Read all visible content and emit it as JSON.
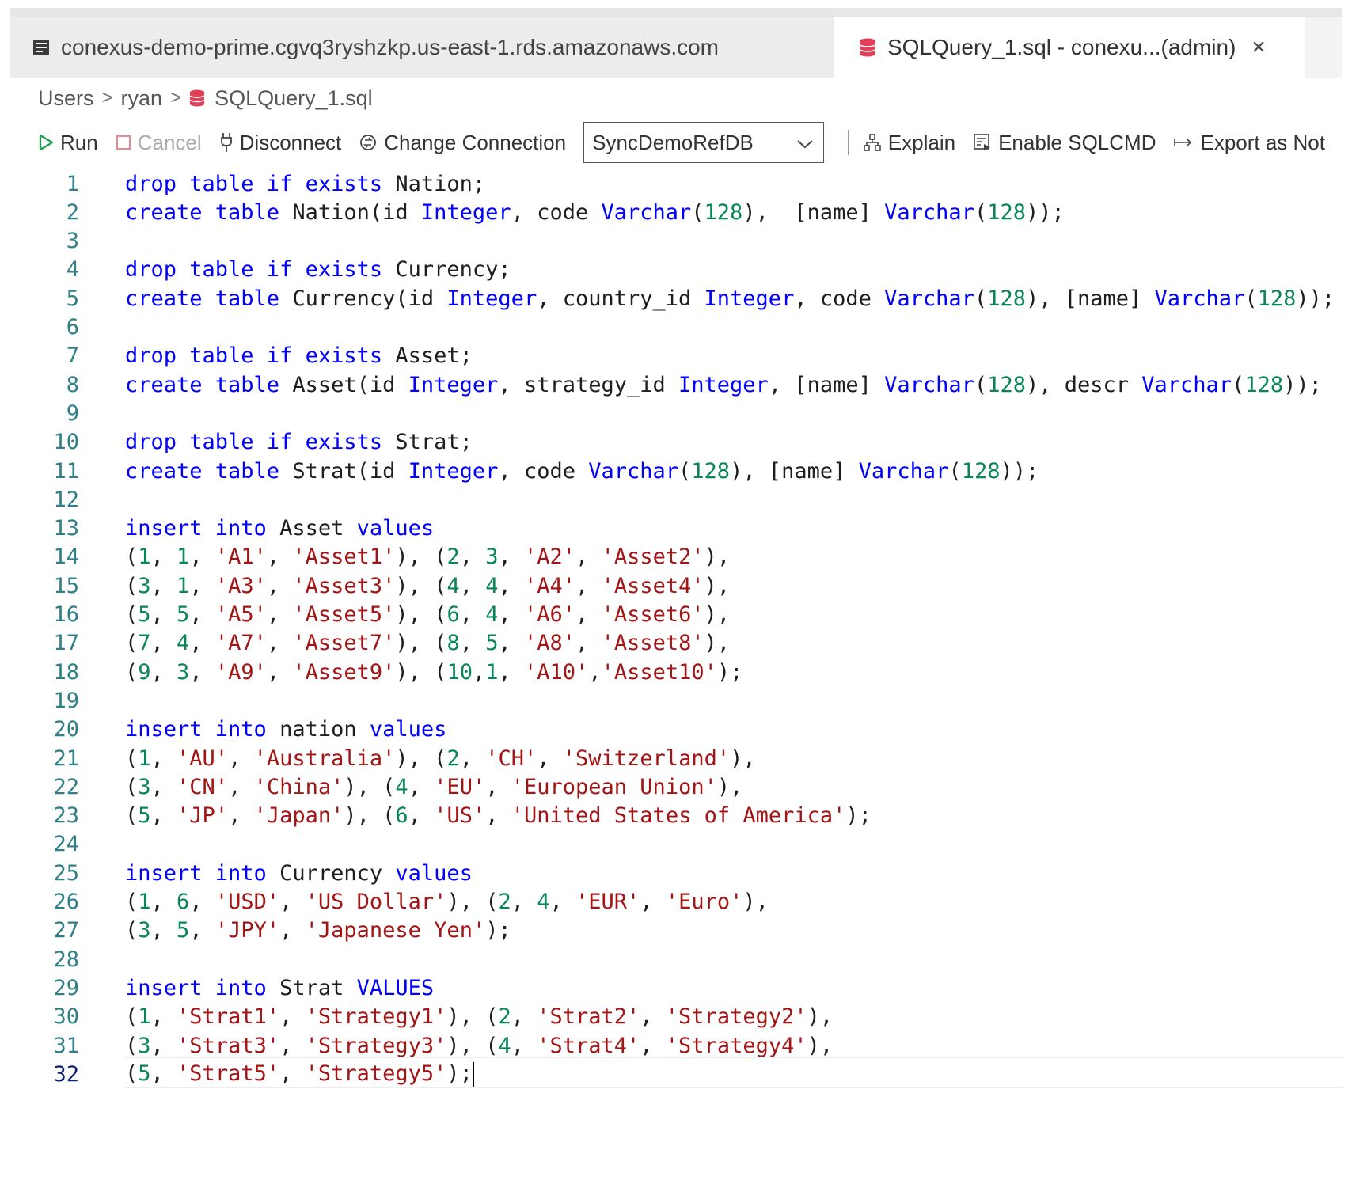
{
  "tabs": [
    {
      "label": "conexus-demo-prime.cgvq3ryshzkp.us-east-1.rds.amazonaws.com",
      "icon": "server-icon"
    },
    {
      "label": "SQLQuery_1.sql - conexu...(admin)",
      "icon": "database-icon",
      "close": "×"
    }
  ],
  "breadcrumb": {
    "items": [
      "Users",
      "ryan",
      "SQLQuery_1.sql"
    ],
    "separator": ">"
  },
  "toolbar": {
    "run": "Run",
    "cancel": "Cancel",
    "disconnect": "Disconnect",
    "change_connection": "Change Connection",
    "database": "SyncDemoRefDB",
    "explain": "Explain",
    "enable_sqlcmd": "Enable SQLCMD",
    "export": "Export as Not"
  },
  "colors": {
    "keyword": "#0000ff",
    "number": "#098658",
    "string": "#a31515",
    "line_number": "#2f7f88",
    "db_icon": "#e0405a"
  },
  "editor": {
    "current_line": 32,
    "lines": [
      [
        [
          "kw",
          "drop table if exists"
        ],
        [
          "p",
          " Nation;"
        ]
      ],
      [
        [
          "kw",
          "create table"
        ],
        [
          "p",
          " Nation(id "
        ],
        [
          "kw",
          "Integer"
        ],
        [
          "p",
          ", code "
        ],
        [
          "kw",
          "Varchar"
        ],
        [
          "p",
          "("
        ],
        [
          "n",
          "128"
        ],
        [
          "p",
          "),  [name] "
        ],
        [
          "kw",
          "Varchar"
        ],
        [
          "p",
          "("
        ],
        [
          "n",
          "128"
        ],
        [
          "p",
          "));"
        ]
      ],
      [],
      [
        [
          "kw",
          "drop table if exists"
        ],
        [
          "p",
          " Currency;"
        ]
      ],
      [
        [
          "kw",
          "create table"
        ],
        [
          "p",
          " Currency(id "
        ],
        [
          "kw",
          "Integer"
        ],
        [
          "p",
          ", country_id "
        ],
        [
          "kw",
          "Integer"
        ],
        [
          "p",
          ", code "
        ],
        [
          "kw",
          "Varchar"
        ],
        [
          "p",
          "("
        ],
        [
          "n",
          "128"
        ],
        [
          "p",
          "), [name] "
        ],
        [
          "kw",
          "Varchar"
        ],
        [
          "p",
          "("
        ],
        [
          "n",
          "128"
        ],
        [
          "p",
          "));"
        ]
      ],
      [],
      [
        [
          "kw",
          "drop table if exists"
        ],
        [
          "p",
          " Asset;"
        ]
      ],
      [
        [
          "kw",
          "create table"
        ],
        [
          "p",
          " Asset(id "
        ],
        [
          "kw",
          "Integer"
        ],
        [
          "p",
          ", strategy_id "
        ],
        [
          "kw",
          "Integer"
        ],
        [
          "p",
          ", [name] "
        ],
        [
          "kw",
          "Varchar"
        ],
        [
          "p",
          "("
        ],
        [
          "n",
          "128"
        ],
        [
          "p",
          "), descr "
        ],
        [
          "kw",
          "Varchar"
        ],
        [
          "p",
          "("
        ],
        [
          "n",
          "128"
        ],
        [
          "p",
          "));"
        ]
      ],
      [],
      [
        [
          "kw",
          "drop table if exists"
        ],
        [
          "p",
          " Strat;"
        ]
      ],
      [
        [
          "kw",
          "create table"
        ],
        [
          "p",
          " Strat(id "
        ],
        [
          "kw",
          "Integer"
        ],
        [
          "p",
          ", code "
        ],
        [
          "kw",
          "Varchar"
        ],
        [
          "p",
          "("
        ],
        [
          "n",
          "128"
        ],
        [
          "p",
          "), [name] "
        ],
        [
          "kw",
          "Varchar"
        ],
        [
          "p",
          "("
        ],
        [
          "n",
          "128"
        ],
        [
          "p",
          "));"
        ]
      ],
      [],
      [
        [
          "kw",
          "insert into"
        ],
        [
          "p",
          " Asset "
        ],
        [
          "kw",
          "values"
        ]
      ],
      [
        [
          "p",
          "("
        ],
        [
          "n",
          "1"
        ],
        [
          "p",
          ", "
        ],
        [
          "n",
          "1"
        ],
        [
          "p",
          ", "
        ],
        [
          "s",
          "'A1'"
        ],
        [
          "p",
          ", "
        ],
        [
          "s",
          "'Asset1'"
        ],
        [
          "p",
          "), ("
        ],
        [
          "n",
          "2"
        ],
        [
          "p",
          ", "
        ],
        [
          "n",
          "3"
        ],
        [
          "p",
          ", "
        ],
        [
          "s",
          "'A2'"
        ],
        [
          "p",
          ", "
        ],
        [
          "s",
          "'Asset2'"
        ],
        [
          "p",
          "),"
        ]
      ],
      [
        [
          "p",
          "("
        ],
        [
          "n",
          "3"
        ],
        [
          "p",
          ", "
        ],
        [
          "n",
          "1"
        ],
        [
          "p",
          ", "
        ],
        [
          "s",
          "'A3'"
        ],
        [
          "p",
          ", "
        ],
        [
          "s",
          "'Asset3'"
        ],
        [
          "p",
          "), ("
        ],
        [
          "n",
          "4"
        ],
        [
          "p",
          ", "
        ],
        [
          "n",
          "4"
        ],
        [
          "p",
          ", "
        ],
        [
          "s",
          "'A4'"
        ],
        [
          "p",
          ", "
        ],
        [
          "s",
          "'Asset4'"
        ],
        [
          "p",
          "),"
        ]
      ],
      [
        [
          "p",
          "("
        ],
        [
          "n",
          "5"
        ],
        [
          "p",
          ", "
        ],
        [
          "n",
          "5"
        ],
        [
          "p",
          ", "
        ],
        [
          "s",
          "'A5'"
        ],
        [
          "p",
          ", "
        ],
        [
          "s",
          "'Asset5'"
        ],
        [
          "p",
          "), ("
        ],
        [
          "n",
          "6"
        ],
        [
          "p",
          ", "
        ],
        [
          "n",
          "4"
        ],
        [
          "p",
          ", "
        ],
        [
          "s",
          "'A6'"
        ],
        [
          "p",
          ", "
        ],
        [
          "s",
          "'Asset6'"
        ],
        [
          "p",
          "),"
        ]
      ],
      [
        [
          "p",
          "("
        ],
        [
          "n",
          "7"
        ],
        [
          "p",
          ", "
        ],
        [
          "n",
          "4"
        ],
        [
          "p",
          ", "
        ],
        [
          "s",
          "'A7'"
        ],
        [
          "p",
          ", "
        ],
        [
          "s",
          "'Asset7'"
        ],
        [
          "p",
          "), ("
        ],
        [
          "n",
          "8"
        ],
        [
          "p",
          ", "
        ],
        [
          "n",
          "5"
        ],
        [
          "p",
          ", "
        ],
        [
          "s",
          "'A8'"
        ],
        [
          "p",
          ", "
        ],
        [
          "s",
          "'Asset8'"
        ],
        [
          "p",
          "),"
        ]
      ],
      [
        [
          "p",
          "("
        ],
        [
          "n",
          "9"
        ],
        [
          "p",
          ", "
        ],
        [
          "n",
          "3"
        ],
        [
          "p",
          ", "
        ],
        [
          "s",
          "'A9'"
        ],
        [
          "p",
          ", "
        ],
        [
          "s",
          "'Asset9'"
        ],
        [
          "p",
          "), ("
        ],
        [
          "n",
          "10"
        ],
        [
          "p",
          ","
        ],
        [
          "n",
          "1"
        ],
        [
          "p",
          ", "
        ],
        [
          "s",
          "'A10'"
        ],
        [
          "p",
          ","
        ],
        [
          "s",
          "'Asset10'"
        ],
        [
          "p",
          ");"
        ]
      ],
      [],
      [
        [
          "kw",
          "insert into"
        ],
        [
          "p",
          " nation "
        ],
        [
          "kw",
          "values"
        ]
      ],
      [
        [
          "p",
          "("
        ],
        [
          "n",
          "1"
        ],
        [
          "p",
          ", "
        ],
        [
          "s",
          "'AU'"
        ],
        [
          "p",
          ", "
        ],
        [
          "s",
          "'Australia'"
        ],
        [
          "p",
          "), ("
        ],
        [
          "n",
          "2"
        ],
        [
          "p",
          ", "
        ],
        [
          "s",
          "'CH'"
        ],
        [
          "p",
          ", "
        ],
        [
          "s",
          "'Switzerland'"
        ],
        [
          "p",
          "),"
        ]
      ],
      [
        [
          "p",
          "("
        ],
        [
          "n",
          "3"
        ],
        [
          "p",
          ", "
        ],
        [
          "s",
          "'CN'"
        ],
        [
          "p",
          ", "
        ],
        [
          "s",
          "'China'"
        ],
        [
          "p",
          "), ("
        ],
        [
          "n",
          "4"
        ],
        [
          "p",
          ", "
        ],
        [
          "s",
          "'EU'"
        ],
        [
          "p",
          ", "
        ],
        [
          "s",
          "'European Union'"
        ],
        [
          "p",
          "),"
        ]
      ],
      [
        [
          "p",
          "("
        ],
        [
          "n",
          "5"
        ],
        [
          "p",
          ", "
        ],
        [
          "s",
          "'JP'"
        ],
        [
          "p",
          ", "
        ],
        [
          "s",
          "'Japan'"
        ],
        [
          "p",
          "), ("
        ],
        [
          "n",
          "6"
        ],
        [
          "p",
          ", "
        ],
        [
          "s",
          "'US'"
        ],
        [
          "p",
          ", "
        ],
        [
          "s",
          "'United States of America'"
        ],
        [
          "p",
          ");"
        ]
      ],
      [],
      [
        [
          "kw",
          "insert into"
        ],
        [
          "p",
          " Currency "
        ],
        [
          "kw",
          "values"
        ]
      ],
      [
        [
          "p",
          "("
        ],
        [
          "n",
          "1"
        ],
        [
          "p",
          ", "
        ],
        [
          "n",
          "6"
        ],
        [
          "p",
          ", "
        ],
        [
          "s",
          "'USD'"
        ],
        [
          "p",
          ", "
        ],
        [
          "s",
          "'US Dollar'"
        ],
        [
          "p",
          "), ("
        ],
        [
          "n",
          "2"
        ],
        [
          "p",
          ", "
        ],
        [
          "n",
          "4"
        ],
        [
          "p",
          ", "
        ],
        [
          "s",
          "'EUR'"
        ],
        [
          "p",
          ", "
        ],
        [
          "s",
          "'Euro'"
        ],
        [
          "p",
          "),"
        ]
      ],
      [
        [
          "p",
          "("
        ],
        [
          "n",
          "3"
        ],
        [
          "p",
          ", "
        ],
        [
          "n",
          "5"
        ],
        [
          "p",
          ", "
        ],
        [
          "s",
          "'JPY'"
        ],
        [
          "p",
          ", "
        ],
        [
          "s",
          "'Japanese Yen'"
        ],
        [
          "p",
          ");"
        ]
      ],
      [],
      [
        [
          "kw",
          "insert into"
        ],
        [
          "p",
          " Strat "
        ],
        [
          "kw",
          "VALUES"
        ]
      ],
      [
        [
          "p",
          "("
        ],
        [
          "n",
          "1"
        ],
        [
          "p",
          ", "
        ],
        [
          "s",
          "'Strat1'"
        ],
        [
          "p",
          ", "
        ],
        [
          "s",
          "'Strategy1'"
        ],
        [
          "p",
          "), ("
        ],
        [
          "n",
          "2"
        ],
        [
          "p",
          ", "
        ],
        [
          "s",
          "'Strat2'"
        ],
        [
          "p",
          ", "
        ],
        [
          "s",
          "'Strategy2'"
        ],
        [
          "p",
          "),"
        ]
      ],
      [
        [
          "p",
          "("
        ],
        [
          "n",
          "3"
        ],
        [
          "p",
          ", "
        ],
        [
          "s",
          "'Strat3'"
        ],
        [
          "p",
          ", "
        ],
        [
          "s",
          "'Strategy3'"
        ],
        [
          "p",
          "), ("
        ],
        [
          "n",
          "4"
        ],
        [
          "p",
          ", "
        ],
        [
          "s",
          "'Strat4'"
        ],
        [
          "p",
          ", "
        ],
        [
          "s",
          "'Strategy4'"
        ],
        [
          "p",
          "),"
        ]
      ],
      [
        [
          "p",
          "("
        ],
        [
          "n",
          "5"
        ],
        [
          "p",
          ", "
        ],
        [
          "s",
          "'Strat5'"
        ],
        [
          "p",
          ", "
        ],
        [
          "s",
          "'Strategy5'"
        ],
        [
          "p",
          ");"
        ]
      ]
    ]
  }
}
